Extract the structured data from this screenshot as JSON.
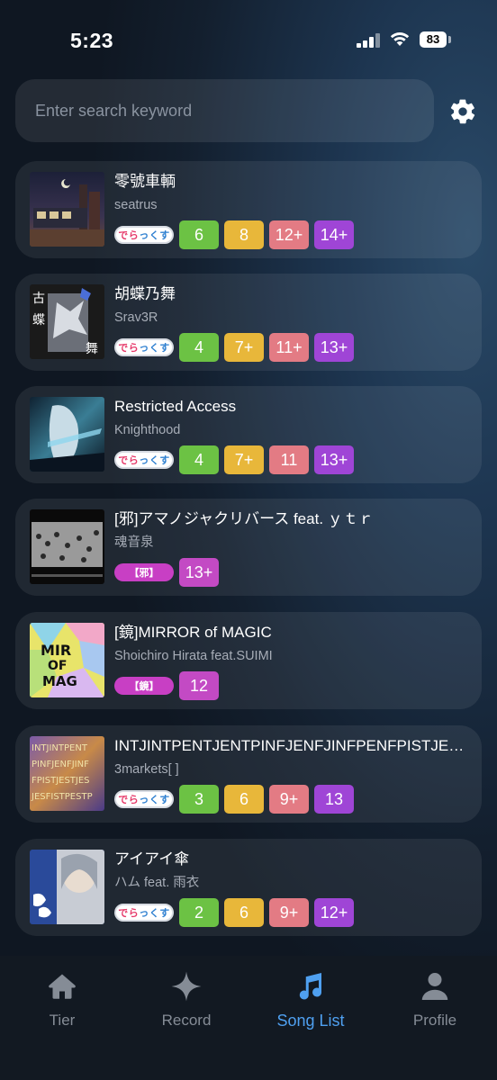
{
  "status": {
    "time": "5:23",
    "battery": "83"
  },
  "search": {
    "placeholder": "Enter search keyword"
  },
  "songs": [
    {
      "title": "零號車輌",
      "artist": "seatrus",
      "tag": "standard",
      "levels": [
        "6",
        "8",
        "12+",
        "14+"
      ]
    },
    {
      "title": "胡蝶乃舞",
      "artist": "Srav3R",
      "tag": "standard",
      "levels": [
        "4",
        "7+",
        "11+",
        "13+"
      ]
    },
    {
      "title": "Restricted Access",
      "artist": "Knighthood",
      "tag": "standard",
      "levels": [
        "4",
        "7+",
        "11",
        "13+"
      ]
    },
    {
      "title": "[邪]アマノジャクリバース feat. ｙｔｒ",
      "artist": "魂音泉",
      "tag": "邪",
      "levels": [
        "13+"
      ]
    },
    {
      "title": "[鏡]MIRROR of MAGIC",
      "artist": "Shoichiro Hirata feat.SUIMI",
      "tag": "鏡",
      "levels": [
        "12"
      ]
    },
    {
      "title": "INTJINTPENTJENTPINFJENFJINFPENFPISTJESTJISFJESFJISTPESTPISFPESFP",
      "artist": "3markets[ ]",
      "tag": "standard",
      "levels": [
        "3",
        "6",
        "9+",
        "13"
      ]
    },
    {
      "title": "アイアイ傘",
      "artist": "ハム feat. 雨衣",
      "tag": "standard",
      "levels": [
        "2",
        "6",
        "9+",
        "12+"
      ]
    }
  ],
  "standard_tag": {
    "part1": "でら",
    "part2": "っくす"
  },
  "tabs": [
    {
      "label": "Tier",
      "icon": "house-icon"
    },
    {
      "label": "Record",
      "icon": "sparkle-icon"
    },
    {
      "label": "Song List",
      "icon": "music-note-icon"
    },
    {
      "label": "Profile",
      "icon": "person-icon"
    }
  ],
  "colors": {
    "basic": "#6cc244",
    "advanced": "#e8b73a",
    "expert": "#e37b84",
    "master": "#9f45d6",
    "special": "#c34ac4",
    "active_tab": "#4fa0f0"
  }
}
